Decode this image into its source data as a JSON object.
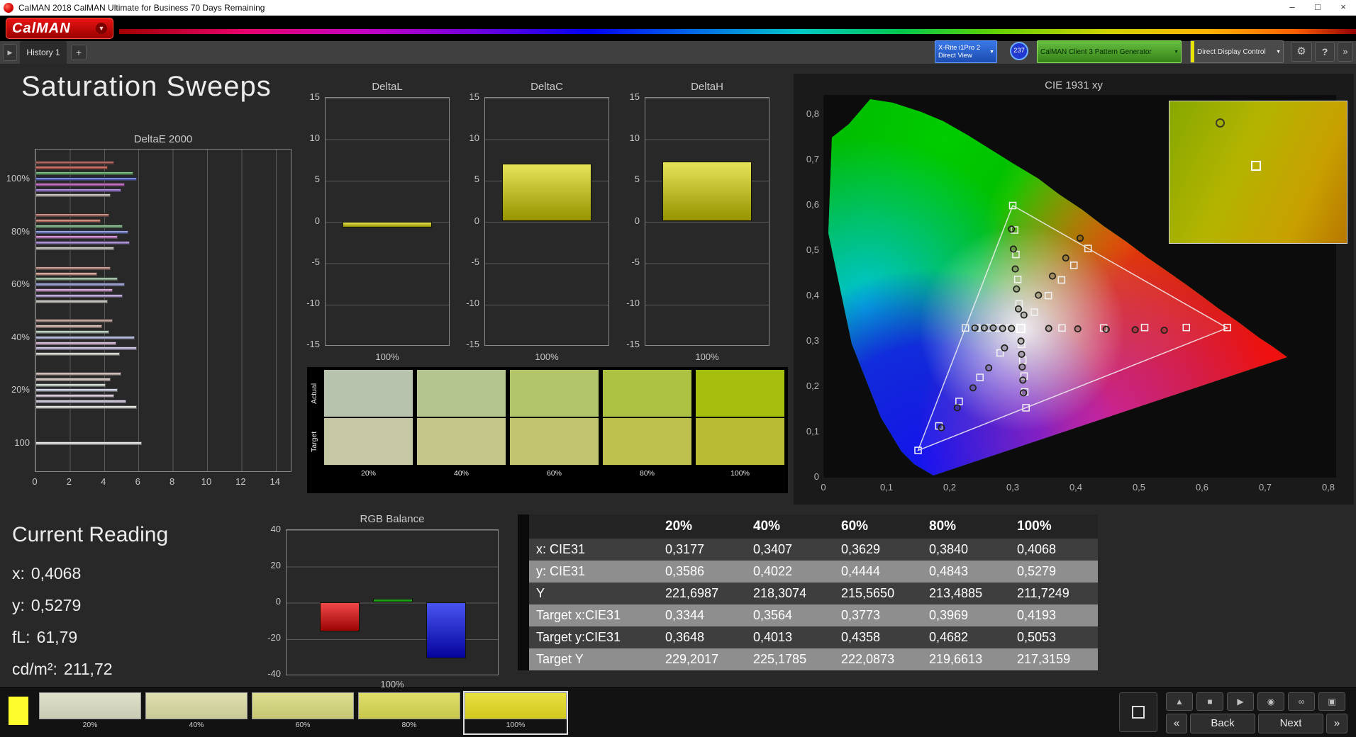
{
  "colors": {
    "app_background": "#282828",
    "panel_background": "#1a1a1a",
    "titlebar_background": "#ffffff",
    "brand_red": "#d40000",
    "meter_blue": "#2f6fe0",
    "source_green": "#4aa827",
    "display_yellow": "#e8e400",
    "bar_yellow": "#d8d400",
    "rgb_red": "#d42020",
    "rgb_green": "#28a428",
    "rgb_blue": "#2838d4",
    "table_row_dark": "#3e3e3e",
    "table_row_light": "#8e8e8e"
  },
  "window": {
    "title": "CalMAN 2018 CalMAN Ultimate for Business 70 Days Remaining",
    "controls": {
      "minimize": "–",
      "maximize": "□",
      "close": "×"
    }
  },
  "brand": {
    "logo_text": "CalMAN"
  },
  "tab_bar": {
    "history_tab": "History 1",
    "add_tab": "+",
    "nav_arrow": "▶",
    "overflow_arrow": "»"
  },
  "devices": {
    "caret": "▼",
    "meter_line1": "X-Rite i1Pro 2",
    "meter_line2": "Direct View",
    "meter_badge": "237",
    "source_label": "CalMAN Client 3 Pattern Generator",
    "display_label": "Direct Display Control",
    "settings_icon": "⚙",
    "help_icon": "?"
  },
  "page": {
    "title": "Saturation Sweeps"
  },
  "chart_data": [
    {
      "type": "bar",
      "orientation": "horizontal",
      "title": "DeltaE 2000",
      "xlim": [
        0,
        15
      ],
      "xticks": [
        0,
        2,
        4,
        6,
        8,
        10,
        12,
        14
      ],
      "groups": [
        {
          "label": "100%",
          "values": [
            4.6,
            4.2,
            5.7,
            5.9,
            5.2,
            5.0,
            4.4
          ],
          "colors": [
            "#9c3a30",
            "#c84638",
            "#3e9e4a",
            "#3e50cc",
            "#bc48bc",
            "#8656cc",
            "#b8b0a8"
          ]
        },
        {
          "label": "80%",
          "values": [
            4.3,
            3.8,
            5.1,
            5.4,
            4.8,
            5.5,
            4.6
          ],
          "colors": [
            "#a65648",
            "#cc6a58",
            "#62aa6c",
            "#6270d2",
            "#c468c4",
            "#9c76d4",
            "#c2bcb4"
          ]
        },
        {
          "label": "60%",
          "values": [
            4.4,
            3.6,
            4.8,
            5.2,
            4.5,
            5.1,
            4.2
          ],
          "colors": [
            "#b0746a",
            "#d28e80",
            "#8ab690",
            "#8a94da",
            "#ce8cce",
            "#b296dc",
            "#ccc8c0"
          ]
        },
        {
          "label": "40%",
          "values": [
            4.5,
            3.9,
            4.3,
            5.8,
            4.7,
            5.9,
            4.9
          ],
          "colors": [
            "#bc948c",
            "#d8aca4",
            "#acc6b0",
            "#acb2e2",
            "#d8aed8",
            "#c4b6e4",
            "#d6d4cc"
          ]
        },
        {
          "label": "20%",
          "values": [
            5.0,
            4.4,
            4.1,
            4.8,
            4.6,
            5.3,
            5.9
          ],
          "colors": [
            "#ccb4ae",
            "#e0cac4",
            "#cadacc",
            "#cacee8",
            "#e2cce2",
            "#d6cce8",
            "#e2e0da"
          ]
        },
        {
          "label": "100",
          "values": [
            6.2
          ],
          "colors": [
            "#ececec"
          ]
        }
      ]
    },
    {
      "type": "bar",
      "title": "DeltaL",
      "categories": [
        "100%"
      ],
      "values": [
        -0.7
      ],
      "ylim": [
        -15,
        15
      ],
      "yticks": [
        15,
        10,
        5,
        0,
        -5,
        -10,
        -15
      ],
      "bar_color": "#d8d400"
    },
    {
      "type": "bar",
      "title": "DeltaC",
      "categories": [
        "100%"
      ],
      "values": [
        7.0
      ],
      "ylim": [
        -15,
        15
      ],
      "yticks": [
        15,
        10,
        5,
        0,
        -5,
        -10,
        -15
      ],
      "bar_color": "#d8d400"
    },
    {
      "type": "bar",
      "title": "DeltaH",
      "categories": [
        "100%"
      ],
      "values": [
        7.3
      ],
      "ylim": [
        -15,
        15
      ],
      "yticks": [
        15,
        10,
        5,
        0,
        -5,
        -10,
        -15
      ],
      "bar_color": "#d8d400"
    },
    {
      "type": "bar",
      "title": "RGB Balance",
      "categories": [
        "100%"
      ],
      "ylim": [
        -40,
        40
      ],
      "yticks": [
        40,
        20,
        0,
        -20,
        -40
      ],
      "series": [
        {
          "name": "Red",
          "values": [
            -16
          ],
          "color_top": "#f04848",
          "color_bottom": "#9c0404"
        },
        {
          "name": "Green",
          "values": [
            2
          ],
          "color_top": "#30c030",
          "color_bottom": "#0a7a0a"
        },
        {
          "name": "Blue",
          "values": [
            -31
          ],
          "color_top": "#4854f0",
          "color_bottom": "#04049c"
        }
      ]
    },
    {
      "type": "scatter",
      "title": "CIE 1931 xy",
      "xlim": [
        0,
        0.812
      ],
      "ylim": [
        0,
        0.843
      ],
      "xtick_labels": [
        "0",
        "0,1",
        "0,2",
        "0,3",
        "0,4",
        "0,5",
        "0,6",
        "0,7",
        "0,8"
      ],
      "ytick_labels": [
        "0",
        "0,1",
        "0,2",
        "0,3",
        "0,4",
        "0,5",
        "0,6",
        "0,7",
        "0,8"
      ],
      "gamut_triangle": [
        [
          0.64,
          0.33
        ],
        [
          0.3,
          0.6
        ],
        [
          0.15,
          0.06
        ]
      ],
      "white_point": [
        0.3127,
        0.329
      ],
      "target_points": [
        [
          0.378,
          0.33
        ],
        [
          0.444,
          0.33
        ],
        [
          0.509,
          0.331
        ],
        [
          0.575,
          0.331
        ],
        [
          0.64,
          0.331
        ],
        [
          0.31,
          0.383
        ],
        [
          0.308,
          0.437
        ],
        [
          0.305,
          0.492
        ],
        [
          0.303,
          0.546
        ],
        [
          0.3,
          0.6
        ],
        [
          0.28,
          0.275
        ],
        [
          0.248,
          0.221
        ],
        [
          0.215,
          0.168
        ],
        [
          0.183,
          0.114
        ],
        [
          0.15,
          0.06
        ],
        [
          0.3344,
          0.3648
        ],
        [
          0.3564,
          0.4013
        ],
        [
          0.3773,
          0.4358
        ],
        [
          0.3969,
          0.4682
        ],
        [
          0.4193,
          0.5053
        ],
        [
          0.295,
          0.33
        ],
        [
          0.278,
          0.33
        ],
        [
          0.26,
          0.33
        ],
        [
          0.243,
          0.33
        ],
        [
          0.225,
          0.33
        ],
        [
          0.314,
          0.294
        ],
        [
          0.316,
          0.259
        ],
        [
          0.318,
          0.224
        ],
        [
          0.319,
          0.189
        ],
        [
          0.321,
          0.154
        ]
      ],
      "measured_points": [
        [
          0.357,
          0.329
        ],
        [
          0.403,
          0.328
        ],
        [
          0.448,
          0.327
        ],
        [
          0.494,
          0.326
        ],
        [
          0.54,
          0.325
        ],
        [
          0.309,
          0.372
        ],
        [
          0.306,
          0.416
        ],
        [
          0.304,
          0.46
        ],
        [
          0.301,
          0.504
        ],
        [
          0.298,
          0.548
        ],
        [
          0.287,
          0.286
        ],
        [
          0.262,
          0.242
        ],
        [
          0.237,
          0.198
        ],
        [
          0.212,
          0.154
        ],
        [
          0.187,
          0.11
        ],
        [
          0.3177,
          0.3586
        ],
        [
          0.3407,
          0.4022
        ],
        [
          0.3629,
          0.4444
        ],
        [
          0.384,
          0.4843
        ],
        [
          0.4068,
          0.5279
        ],
        [
          0.298,
          0.329
        ],
        [
          0.284,
          0.329
        ],
        [
          0.269,
          0.33
        ],
        [
          0.255,
          0.33
        ],
        [
          0.24,
          0.33
        ],
        [
          0.313,
          0.301
        ],
        [
          0.314,
          0.272
        ],
        [
          0.315,
          0.244
        ],
        [
          0.316,
          0.215
        ],
        [
          0.317,
          0.187
        ]
      ]
    }
  ],
  "color_checker": {
    "row_labels": [
      "Actual",
      "Target"
    ],
    "columns": [
      {
        "label": "20%",
        "actual": "#b7c3ad",
        "target": "#c6c7a3"
      },
      {
        "label": "40%",
        "actual": "#b4c48e",
        "target": "#c4c689"
      },
      {
        "label": "60%",
        "actual": "#b1c46a",
        "target": "#c1c46c"
      },
      {
        "label": "80%",
        "actual": "#adc243",
        "target": "#bec14e"
      },
      {
        "label": "100%",
        "actual": "#a6bf0f",
        "target": "#b9bc33"
      }
    ]
  },
  "current_reading": {
    "title": "Current Reading",
    "lines": [
      {
        "label": "x:",
        "value": "0,4068"
      },
      {
        "label": "y:",
        "value": "0,5279"
      },
      {
        "label": "fL:",
        "value": "61,79"
      },
      {
        "label": "cd/m²:",
        "value": "211,72"
      }
    ]
  },
  "results_table": {
    "header": [
      "",
      "20%",
      "40%",
      "60%",
      "80%",
      "100%"
    ],
    "rows": [
      [
        "x: CIE31",
        "0,3177",
        "0,3407",
        "0,3629",
        "0,3840",
        "0,4068"
      ],
      [
        "y: CIE31",
        "0,3586",
        "0,4022",
        "0,4444",
        "0,4843",
        "0,5279"
      ],
      [
        "Y",
        "221,6987",
        "218,3074",
        "215,5650",
        "213,4885",
        "211,7249"
      ],
      [
        "Target x:CIE31",
        "0,3344",
        "0,3564",
        "0,3773",
        "0,3969",
        "0,4193"
      ],
      [
        "Target y:CIE31",
        "0,3648",
        "0,4013",
        "0,4358",
        "0,4682",
        "0,5053"
      ],
      [
        "Target Y",
        "229,2017",
        "225,1785",
        "222,0873",
        "219,6613",
        "217,3159"
      ]
    ]
  },
  "bottom_bar": {
    "current_patch_color": "#fdfd2e",
    "selected_patch": "100%",
    "patches": [
      {
        "label": "20%",
        "color": "#dadcc2"
      },
      {
        "label": "40%",
        "color": "#d9daa2"
      },
      {
        "label": "60%",
        "color": "#d7d87c"
      },
      {
        "label": "80%",
        "color": "#d9d852"
      },
      {
        "label": "100%",
        "color": "#e4da20"
      }
    ],
    "transport": {
      "buttons": [
        {
          "name": "eject",
          "glyph": "▲"
        },
        {
          "name": "stop",
          "glyph": "■"
        },
        {
          "name": "play",
          "glyph": "▶"
        },
        {
          "name": "capture",
          "glyph": "◉"
        },
        {
          "name": "loop",
          "glyph": "∞"
        },
        {
          "name": "layout",
          "glyph": "▣"
        }
      ],
      "back_chevron": "«",
      "back_label": "Back",
      "next_label": "Next",
      "next_chevron": "»"
    }
  }
}
